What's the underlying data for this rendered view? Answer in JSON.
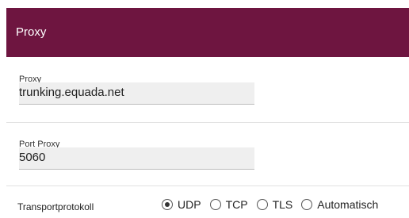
{
  "header": {
    "title": "Proxy"
  },
  "fields": {
    "proxy": {
      "label": "Proxy",
      "value": "trunking.equada.net"
    },
    "port_proxy": {
      "label": "Port Proxy",
      "value": "5060"
    }
  },
  "transport": {
    "label": "Transportprotokoll",
    "options": [
      {
        "label": "UDP",
        "selected": true
      },
      {
        "label": "TCP",
        "selected": false
      },
      {
        "label": "TLS",
        "selected": false
      },
      {
        "label": "Automatisch",
        "selected": false
      }
    ]
  },
  "colors": {
    "header_bg": "#6e1540",
    "input_bg": "#efefef"
  }
}
